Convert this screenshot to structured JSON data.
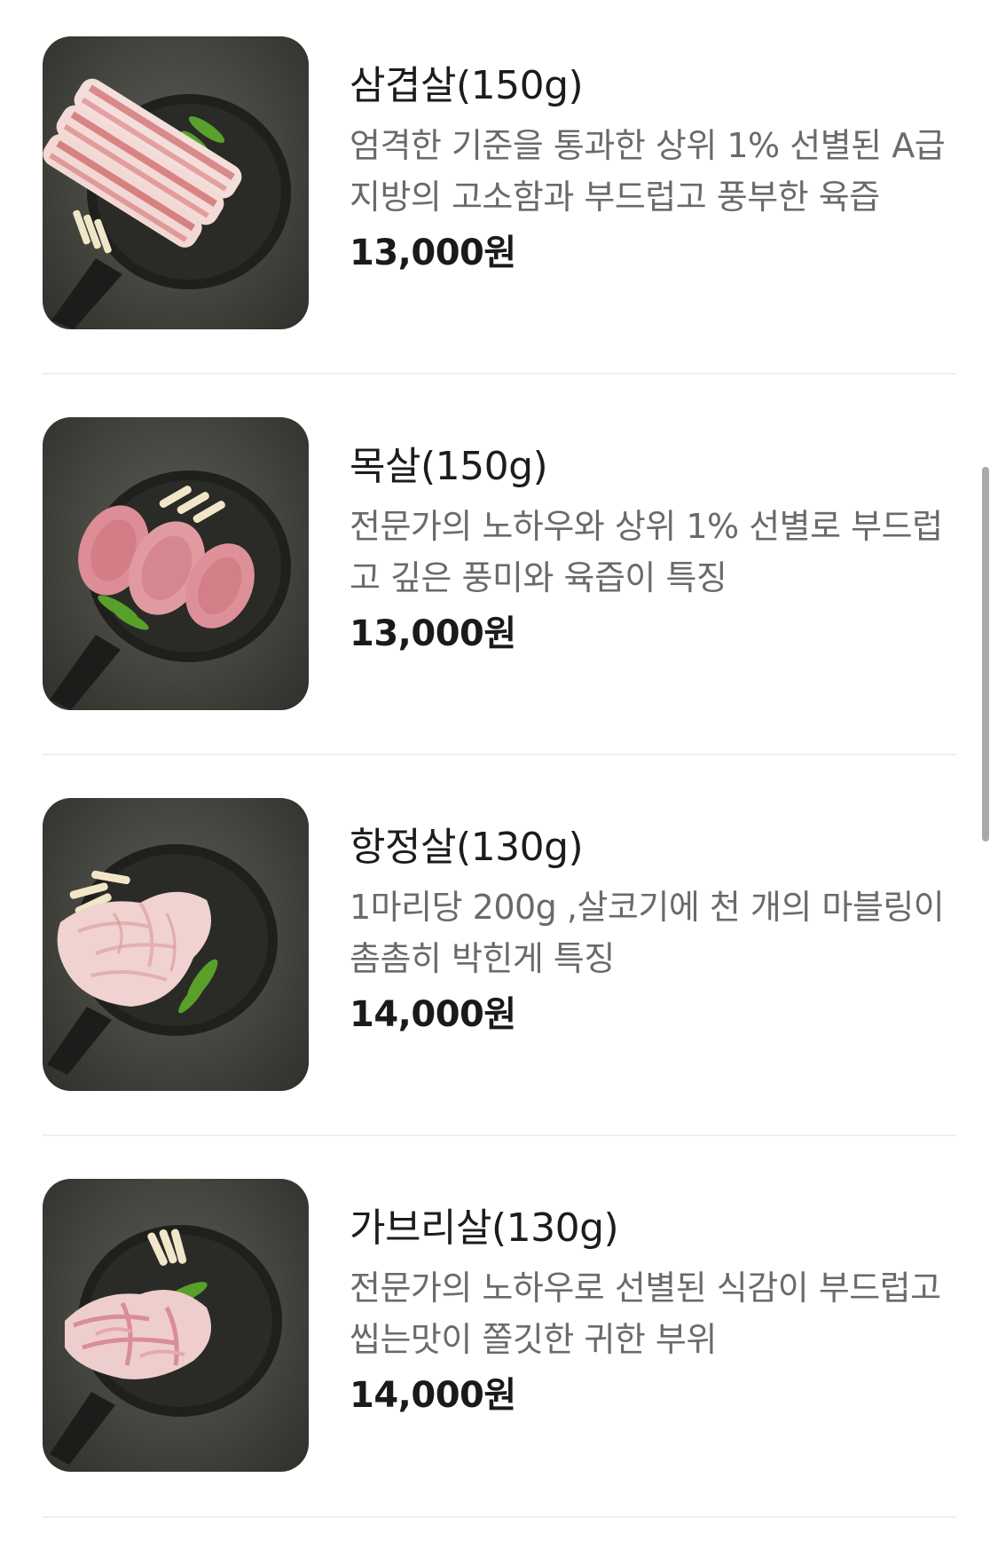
{
  "menu": {
    "items": [
      {
        "name": "삼겹살(150g)",
        "description": "엄격한 기준을 통과한 상위 1% 선별된 A급 지방의 고소함과 부드럽고 풍부한 육즙",
        "price": "13,000원",
        "image": "pork-belly-photo"
      },
      {
        "name": "목살(150g)",
        "description": "전문가의 노하우와 상위 1% 선별로 부드럽고 깊은 풍미와 육즙이 특징",
        "price": "13,000원",
        "image": "pork-neck-photo"
      },
      {
        "name": "항정살(130g)",
        "description": "1마리당 200g ,살코기에 천 개의 마블링이 촘촘히 박힌게 특징",
        "price": "14,000원",
        "image": "pork-jowl-photo"
      },
      {
        "name": "가브리살(130g)",
        "description": "전문가의 노하우로 선별된 식감이 부드럽고 씹는맛이 쫄깃한 귀한 부위",
        "price": "14,000원",
        "image": "pork-shoulder-cap-photo"
      }
    ]
  },
  "colors": {
    "background": "#ffffff",
    "name_text": "#1c1c1c",
    "desc_text": "#6a6a6a",
    "price_text": "#1a1a1a",
    "divider": "#eeeeee",
    "scrollbar": "#a9a9a9",
    "photo_background": "#45453f"
  }
}
